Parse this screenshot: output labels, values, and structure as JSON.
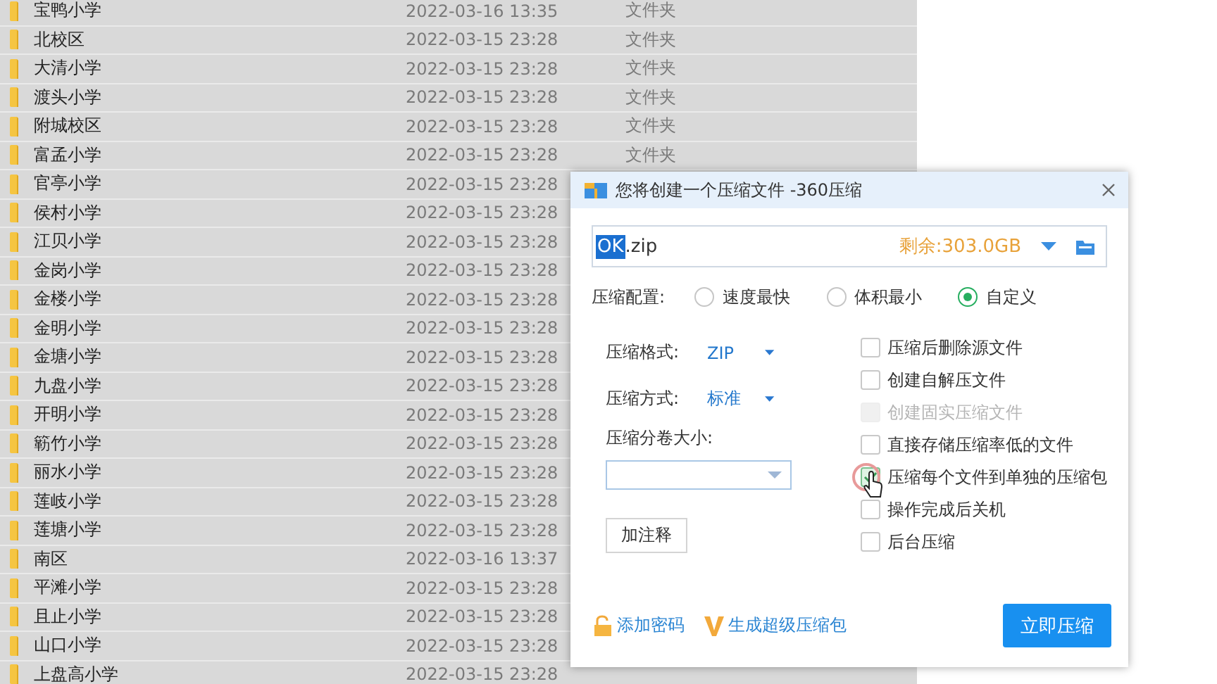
{
  "files": [
    {
      "name": "宝鸭小学",
      "date": "2022-03-16 13:35",
      "type": "文件夹"
    },
    {
      "name": "北校区",
      "date": "2022-03-15 23:28",
      "type": "文件夹"
    },
    {
      "name": "大清小学",
      "date": "2022-03-15 23:28",
      "type": "文件夹"
    },
    {
      "name": "渡头小学",
      "date": "2022-03-15 23:28",
      "type": "文件夹"
    },
    {
      "name": "附城校区",
      "date": "2022-03-15 23:28",
      "type": "文件夹"
    },
    {
      "name": "富孟小学",
      "date": "2022-03-15 23:28",
      "type": "文件夹"
    },
    {
      "name": "官亭小学",
      "date": "2022-03-15 23:28"
    },
    {
      "name": "侯村小学",
      "date": "2022-03-15 23:28"
    },
    {
      "name": "江贝小学",
      "date": "2022-03-15 23:28"
    },
    {
      "name": "金岗小学",
      "date": "2022-03-15 23:28"
    },
    {
      "name": "金楼小学",
      "date": "2022-03-15 23:28"
    },
    {
      "name": "金明小学",
      "date": "2022-03-15 23:28"
    },
    {
      "name": "金塘小学",
      "date": "2022-03-15 23:28"
    },
    {
      "name": "九盘小学",
      "date": "2022-03-15 23:28"
    },
    {
      "name": "开明小学",
      "date": "2022-03-15 23:28"
    },
    {
      "name": "簕竹小学",
      "date": "2022-03-15 23:28"
    },
    {
      "name": "丽水小学",
      "date": "2022-03-15 23:28"
    },
    {
      "name": "莲岐小学",
      "date": "2022-03-15 23:28"
    },
    {
      "name": "莲塘小学",
      "date": "2022-03-15 23:28"
    },
    {
      "name": "南区",
      "date": "2022-03-16 13:37"
    },
    {
      "name": "平滩小学",
      "date": "2022-03-15 23:28"
    },
    {
      "name": "且止小学",
      "date": "2022-03-15 23:28"
    },
    {
      "name": "山口小学",
      "date": "2022-03-15 23:28"
    },
    {
      "name": "上盘高小学",
      "date": "2022-03-15 23:28"
    }
  ],
  "dialog": {
    "title": "您将创建一个压缩文件 -360压缩",
    "filename": {
      "selected_part": "OK",
      "rest": ".zip"
    },
    "free_space": "剩余:303.0GB",
    "profile": {
      "label": "压缩配置:",
      "options": [
        {
          "label": "速度最快",
          "selected": false
        },
        {
          "label": "体积最小",
          "selected": false
        },
        {
          "label": "自定义",
          "selected": true
        }
      ]
    },
    "settings": [
      {
        "label": "压缩格式:",
        "value": "ZIP"
      },
      {
        "label": "压缩方式:",
        "value": "标准"
      }
    ],
    "volume_size": {
      "label": "压缩分卷大小:"
    },
    "comment_button": "加注释",
    "options": [
      {
        "label": "压缩后删除源文件",
        "checked": false,
        "disabled": false
      },
      {
        "label": "创建自解压文件",
        "checked": false,
        "disabled": false
      },
      {
        "label": "创建固实压缩文件",
        "checked": false,
        "disabled": true
      },
      {
        "label": "直接存储压缩率低的文件",
        "checked": false,
        "disabled": false
      },
      {
        "label": "压缩每个文件到单独的压缩包",
        "checked": true,
        "disabled": false
      },
      {
        "label": "操作完成后关机",
        "checked": false,
        "disabled": false
      },
      {
        "label": "后台压缩",
        "checked": false,
        "disabled": false
      }
    ],
    "password_link": "添加密码",
    "super_link": "生成超级压缩包",
    "submit_button": "立即压缩"
  }
}
